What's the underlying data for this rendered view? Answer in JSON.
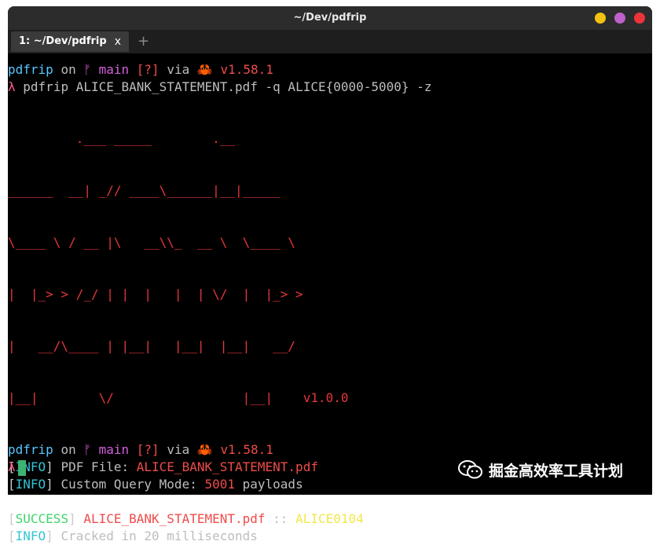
{
  "window": {
    "title": "~/Dev/pdfrip"
  },
  "tabs": [
    {
      "label": "1: ~/Dev/pdfrip",
      "close": "x"
    }
  ],
  "tab_add": "+",
  "prompt": {
    "dir": "pdfrip",
    "on": "on",
    "branch_icon": "ᚠ",
    "branch": "main",
    "status": "[?]",
    "via": "via",
    "lang_icon": "🦀",
    "version": "v1.58.1",
    "symbol": "λ"
  },
  "command": "pdfrip ALICE_BANK_STATEMENT.pdf -q ALICE{0000-5000} -z",
  "banner": {
    "lines": [
      "         .___ _____        .__",
      "______  __| _// ____\\______|__|_____",
      "\\____ \\ / __ |\\   __\\\\_  __ \\  \\____ \\",
      "|  |_> > /_/ | |  |   |  | \\/  |  |_> >",
      "|   __/\\____ | |__|   |__|  |__|   __/",
      "|__|        \\/                 |__|"
    ],
    "version": "v1.0.0"
  },
  "log": [
    {
      "tag": "INFO",
      "text": "PDF File: ",
      "value": "ALICE_BANK_STATEMENT.pdf"
    },
    {
      "tag": "INFO",
      "text": "Custom Query Mode: ",
      "value": "5001",
      "suffix": " payloads"
    },
    {
      "tag": "SUCCESS",
      "file": "ALICE_BANK_STATEMENT.pdf",
      "sep": " :: ",
      "result": "ALICE0104"
    },
    {
      "tag": "INFO",
      "text": "Cracked in 20 milliseconds"
    }
  ],
  "watermark": {
    "text": "掘金高效率工具计划",
    "icon": "wechat-icon"
  },
  "colors": {
    "background": "#000000",
    "prompt_dir": "#57c7ff",
    "branch": "#d65fdd",
    "version": "#ef4b4b",
    "banner": "#e5363b",
    "info": "#32c4d6",
    "success": "#3fd56a",
    "result": "#f1e84a",
    "cursor": "#3cb371"
  }
}
